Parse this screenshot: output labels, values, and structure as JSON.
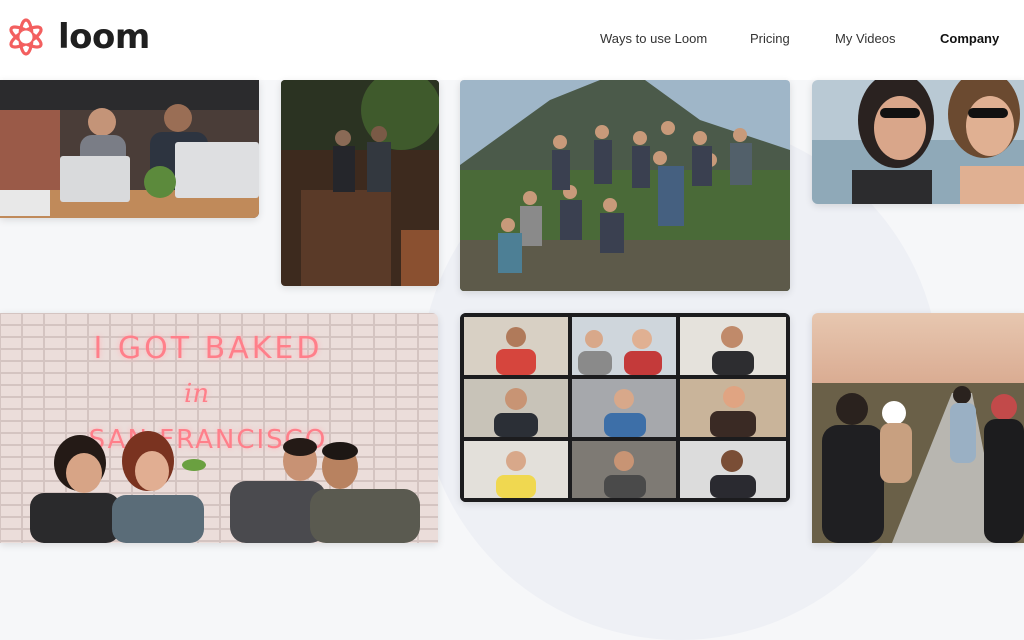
{
  "brand": {
    "name": "loom",
    "accent": "#f35f5f"
  },
  "nav": {
    "items": [
      {
        "label": "Ways to use Loom"
      },
      {
        "label": "Pricing"
      },
      {
        "label": "My Videos"
      },
      {
        "label": "Company",
        "active": true
      }
    ]
  },
  "photos": {
    "neon_sign": {
      "line1": "I GOT BAKED",
      "line2": "in",
      "line3": "SAN FRANCISCO"
    }
  },
  "colors": {
    "page_background": "#f6f7f9",
    "header_background": "#ffffff",
    "neon": "#ff7f8a"
  }
}
